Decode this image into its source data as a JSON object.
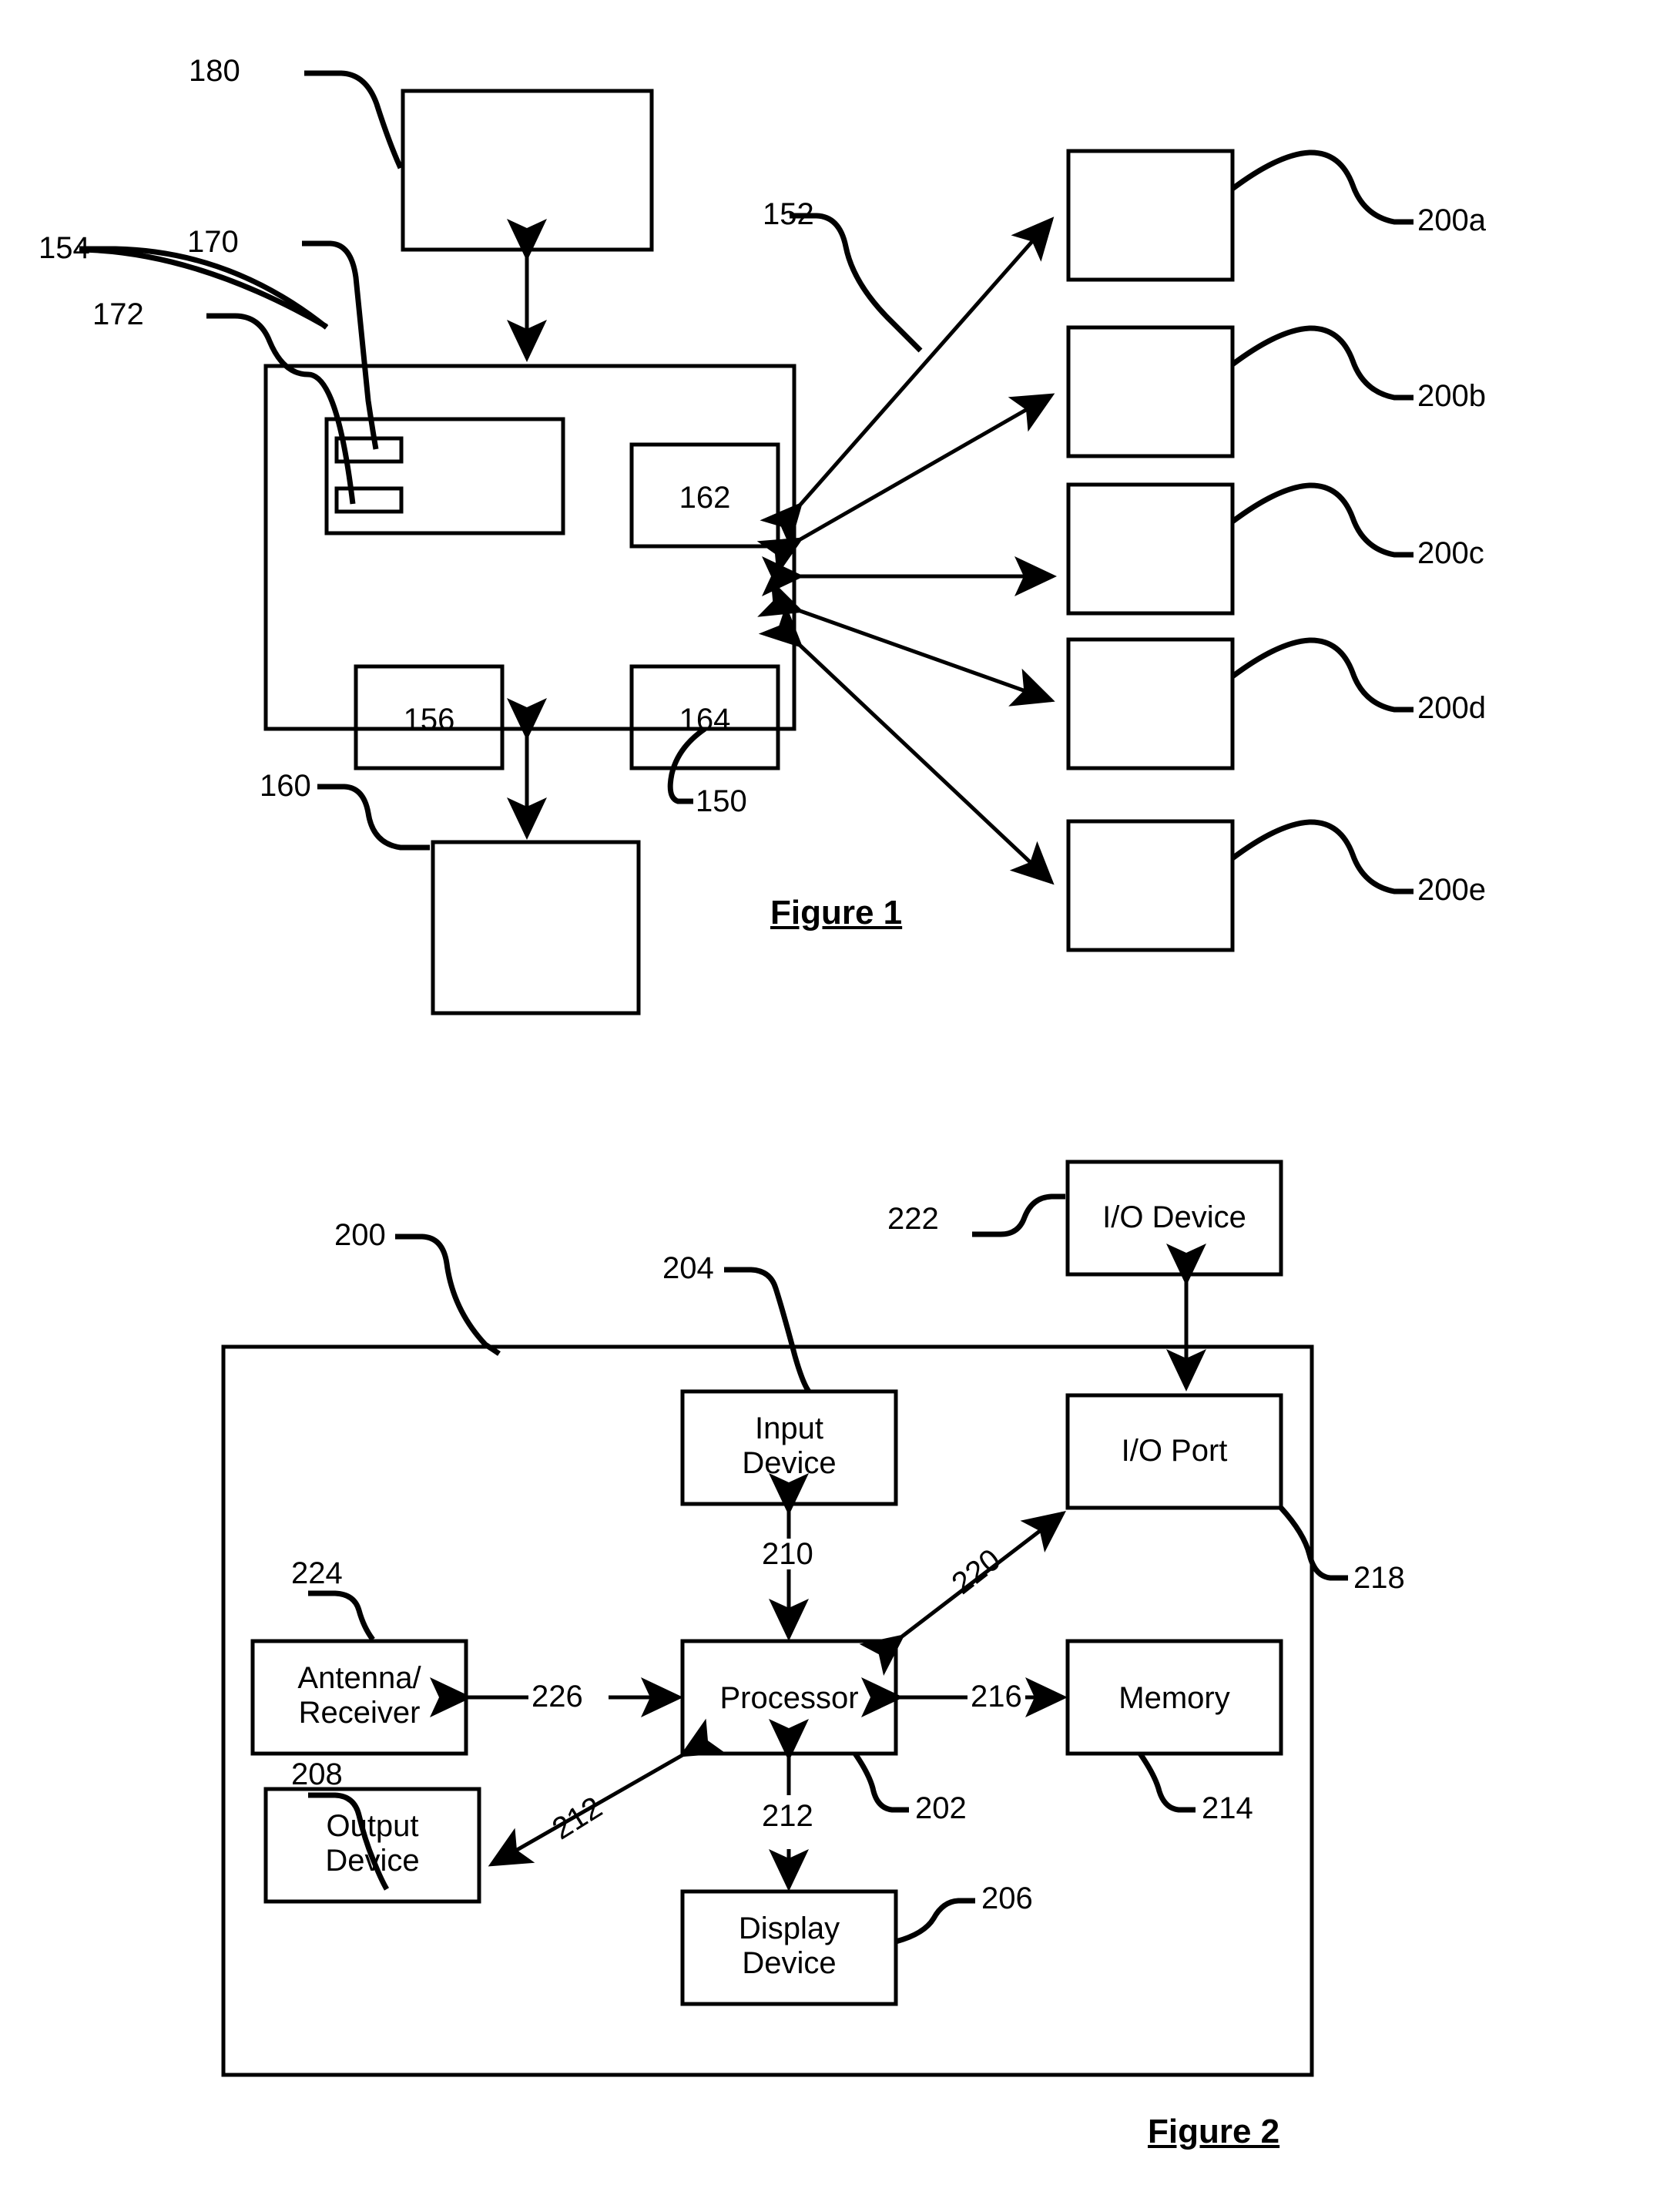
{
  "document": {
    "type": "patent-drawing-sheet",
    "background_color": "#ffffff",
    "line_color": "#000000"
  },
  "figure1": {
    "title": "Figure 1",
    "boxes": [
      {
        "id": "box-180",
        "label": "",
        "ref": "180"
      },
      {
        "id": "box-150",
        "label": "",
        "ref": "150"
      },
      {
        "id": "box-154",
        "label": "",
        "ref": "154"
      },
      {
        "id": "box-170",
        "label": "",
        "ref": "170"
      },
      {
        "id": "box-172",
        "label": "",
        "ref": "172"
      },
      {
        "id": "box-156",
        "label": "156",
        "ref": "156"
      },
      {
        "id": "box-162",
        "label": "162",
        "ref": "162"
      },
      {
        "id": "box-164",
        "label": "164",
        "ref": "164"
      },
      {
        "id": "box-160",
        "label": "",
        "ref": "160"
      },
      {
        "id": "box-200a",
        "label": "",
        "ref": "200a"
      },
      {
        "id": "box-200b",
        "label": "",
        "ref": "200b"
      },
      {
        "id": "box-200c",
        "label": "",
        "ref": "200c"
      },
      {
        "id": "box-200d",
        "label": "",
        "ref": "200d"
      },
      {
        "id": "box-200e",
        "label": "",
        "ref": "200e"
      }
    ],
    "refs": {
      "r180": "180",
      "r170": "170",
      "r154": "154",
      "r172": "172",
      "r156": "156",
      "r162": "162",
      "r164": "164",
      "r150": "150",
      "r160": "160",
      "r152": "152",
      "r200a": "200a",
      "r200b": "200b",
      "r200c": "200c",
      "r200d": "200d",
      "r200e": "200e"
    }
  },
  "figure2": {
    "title": "Figure 2",
    "boxes": [
      {
        "id": "box-io-device",
        "label": "I/O Device",
        "ref": "222"
      },
      {
        "id": "box-io-port",
        "label": "I/O Port",
        "ref": "218"
      },
      {
        "id": "box-input-device",
        "label": "Input\nDevice",
        "ref": "204"
      },
      {
        "id": "box-processor",
        "label": "Processor",
        "ref": "202"
      },
      {
        "id": "box-memory",
        "label": "Memory",
        "ref": "214"
      },
      {
        "id": "box-antenna-receiver",
        "label": "Antenna/\nReceiver",
        "ref": "224"
      },
      {
        "id": "box-output-device",
        "label": "Output\nDevice",
        "ref": "208"
      },
      {
        "id": "box-display-device",
        "label": "Display\nDevice",
        "ref": "206"
      },
      {
        "id": "box-enclosure",
        "label": "",
        "ref": "200"
      }
    ],
    "labels": {
      "io_device": "I/O Device",
      "io_port": "I/O Port",
      "input_device": "Input\nDevice",
      "processor": "Processor",
      "memory": "Memory",
      "antenna_receiver": "Antenna/\nReceiver",
      "output_device": "Output\nDevice",
      "display_device": "Display\nDevice"
    },
    "refs": {
      "r200": "200",
      "r202": "202",
      "r204": "204",
      "r206": "206",
      "r208": "208",
      "r210": "210",
      "r212_diag": "212",
      "r212_vert": "212",
      "r214": "214",
      "r216": "216",
      "r218": "218",
      "r220": "220",
      "r222": "222",
      "r224": "224",
      "r226": "226"
    }
  }
}
